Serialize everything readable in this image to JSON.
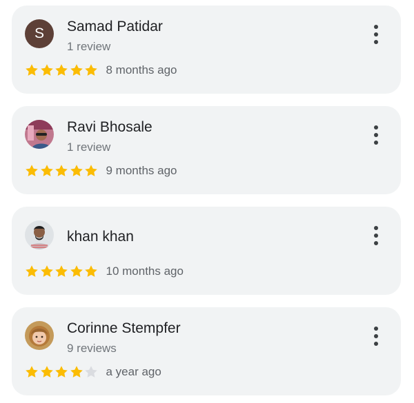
{
  "reviews": [
    {
      "name": "Samad Patidar",
      "review_count": "1 review",
      "avatar_letter": "S",
      "avatar_color": "#5d4037",
      "rating": 5,
      "time": "8 months ago"
    },
    {
      "name": "Ravi Bhosale",
      "review_count": "1 review",
      "avatar_icon": "user-photo-icon",
      "rating": 5,
      "time": "9 months ago"
    },
    {
      "name": "khan khan",
      "review_count": "",
      "avatar_icon": "user-photo-icon",
      "rating": 5,
      "time": "10 months ago"
    },
    {
      "name": "Corinne Stempfer",
      "review_count": "9 reviews",
      "avatar_icon": "user-photo-icon",
      "rating": 4,
      "time": "a year ago"
    }
  ],
  "colors": {
    "star_filled": "#fbbc04",
    "star_empty": "#dadce0",
    "card_bg": "#f1f3f4"
  },
  "icons": {
    "menu": "more-vert-icon",
    "star": "star-icon"
  }
}
